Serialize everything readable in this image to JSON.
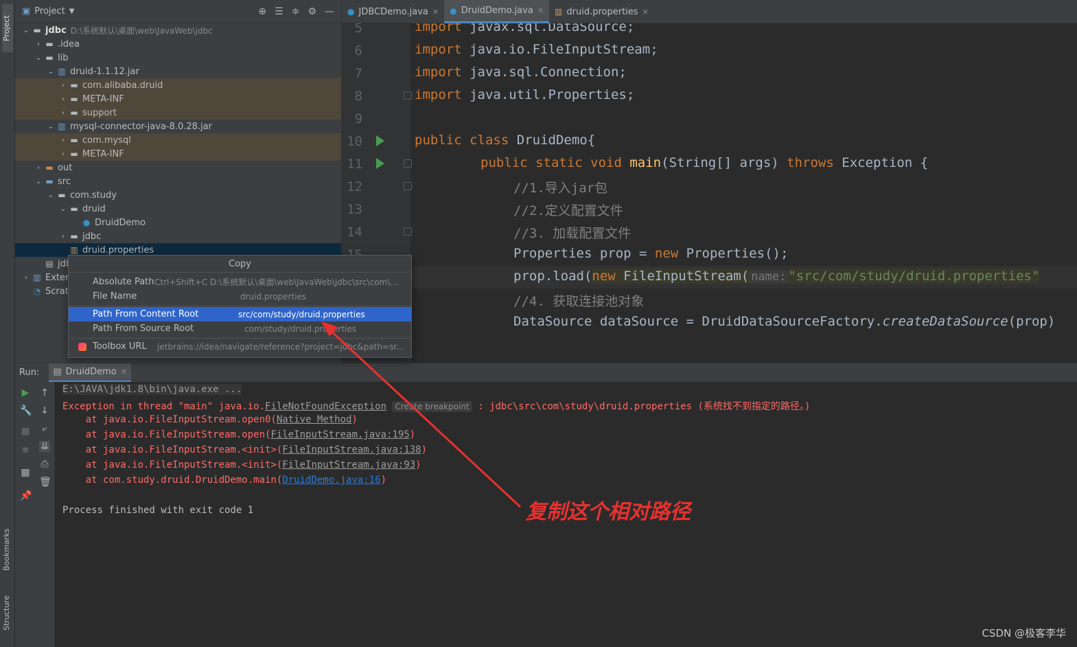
{
  "sidebar_strip": {
    "project": "Project",
    "bookmarks": "Bookmarks",
    "structure": "Structure"
  },
  "project_panel": {
    "title": "Project",
    "tree": [
      {
        "label": "jdbc",
        "hint": "D:\\系统默认\\桌面\\web\\JavaWeb\\jdbc",
        "depth": 0,
        "arrow": "down",
        "icon": "folder-icon"
      },
      {
        "label": ".idea",
        "depth": 1,
        "arrow": "right",
        "icon": "folder-icon"
      },
      {
        "label": "lib",
        "depth": 1,
        "arrow": "down",
        "icon": "folder-icon"
      },
      {
        "label": "druid-1.1.12.jar",
        "depth": 2,
        "arrow": "down",
        "icon": "jar-icon"
      },
      {
        "label": "com.alibaba.druid",
        "depth": 3,
        "arrow": "right",
        "icon": "package-icon"
      },
      {
        "label": "META-INF",
        "depth": 3,
        "arrow": "right",
        "icon": "folder-icon"
      },
      {
        "label": "support",
        "depth": 3,
        "arrow": "right",
        "icon": "folder-icon"
      },
      {
        "label": "mysql-connector-java-8.0.28.jar",
        "depth": 2,
        "arrow": "down",
        "icon": "jar-icon"
      },
      {
        "label": "com.mysql",
        "depth": 3,
        "arrow": "right",
        "icon": "package-icon"
      },
      {
        "label": "META-INF",
        "depth": 3,
        "arrow": "right",
        "icon": "folder-icon"
      },
      {
        "label": "out",
        "depth": 1,
        "arrow": "right",
        "icon": "folder-icon"
      },
      {
        "label": "src",
        "depth": 1,
        "arrow": "down",
        "icon": "folder-icon"
      },
      {
        "label": "com.study",
        "depth": 2,
        "arrow": "down",
        "icon": "package-icon"
      },
      {
        "label": "druid",
        "depth": 3,
        "arrow": "down",
        "icon": "package-icon"
      },
      {
        "label": "DruidDemo",
        "depth": 4,
        "arrow": "",
        "icon": "class-icon"
      },
      {
        "label": "jdbc",
        "depth": 3,
        "arrow": "right",
        "icon": "package-icon"
      },
      {
        "label": "druid.properties",
        "depth": 3,
        "arrow": "",
        "icon": "properties-icon"
      },
      {
        "label": "jdb",
        "depth": 1,
        "arrow": "",
        "icon": "file-icon"
      },
      {
        "label": "Extern",
        "depth": 0,
        "arrow": "right",
        "icon": "library-icon"
      },
      {
        "label": "Scratc",
        "depth": 0,
        "arrow": "",
        "icon": "scratch-icon"
      }
    ]
  },
  "tabs": [
    {
      "label": "JDBCDemo.java",
      "icon": "java-class-icon"
    },
    {
      "label": "DruidDemo.java",
      "icon": "java-class-icon"
    },
    {
      "label": "druid.properties",
      "icon": "properties-file-icon"
    }
  ],
  "editor": {
    "line_numbers": [
      "5",
      "6",
      "7",
      "8",
      "9",
      "10",
      "11",
      "12",
      "13",
      "14",
      "15"
    ],
    "import_kw": "import",
    "imports": [
      "javax.sql.DataSource;",
      "java.io.FileInputStream;",
      "java.sql.Connection;",
      "java.util.Properties;"
    ],
    "l10_public": "public",
    "l10_class": "class",
    "l10_rest": "DruidDemo{",
    "l11_mods": "public static void",
    "l11_main": "main",
    "l11_params": "(String[] args)",
    "l11_throws": "throws",
    "l11_tail": "Exception {",
    "c1": "//1.导入jar包",
    "c2": "//2.定义配置文件",
    "c3": "//3. 加载配置文件",
    "l15_a": "Properties prop = ",
    "l15_new": "new",
    "l15_b": " Properties();",
    "l16_a": "prop.load(",
    "l16_new": "new",
    "l16_b": " FileInputStream(",
    "l16_hint": "name:",
    "l16_str": "\"src/com/study/druid.properties\"",
    "c4": "//4. 获取连接池对象",
    "l18_a": "DataSource dataSource = DruidDataSourceFactory.",
    "l18_m": "createDataSource",
    "l18_b": "(prop)"
  },
  "popup": {
    "title": "Copy",
    "items": [
      {
        "label": "Absolute Path",
        "shortcut": "Ctrl+Shift+C",
        "value": "D:\\系统默认\\桌面\\web\\JavaWeb\\jdbc\\src\\com\\..."
      },
      {
        "label": "File Name",
        "shortcut": "",
        "value": "druid.properties"
      },
      {
        "label": "Path From Content Root",
        "shortcut": "",
        "value": "src/com/study/druid.properties"
      },
      {
        "label": "Path From Source Root",
        "shortcut": "",
        "value": "com/study/druid.properties"
      },
      {
        "label": "Toolbox URL",
        "shortcut": "",
        "value": "jetbrains://idea/navigate/reference?project=jdbc&path=sr..."
      }
    ]
  },
  "run": {
    "label": "Run:",
    "tab": "DruidDemo",
    "console": {
      "cmd": "E:\\JAVA\\jdk1.8\\bin\\java.exe ...",
      "exc_prefix": "Exception in thread \"main\" java.io.",
      "exc_class": "FileNotFoundException",
      "create_bp": "Create breakpoint",
      "exc_tail": ": jdbc\\src\\com\\study\\druid.properties (系统找不到指定的路径。)",
      "stack": [
        {
          "pre": "    at java.io.FileInputStream.open0(",
          "link": "Native Method",
          "post": ")"
        },
        {
          "pre": "    at java.io.FileInputStream.open(",
          "link": "FileInputStream.java:195",
          "post": ")"
        },
        {
          "pre": "    at java.io.FileInputStream.<init>(",
          "link": "FileInputStream.java:138",
          "post": ")"
        },
        {
          "pre": "    at java.io.FileInputStream.<init>(",
          "link": "FileInputStream.java:93",
          "post": ")"
        },
        {
          "pre": "    at com.study.druid.DruidDemo.main(",
          "link": "DruidDemo.java:16",
          "post": ")"
        }
      ],
      "finished": "Process finished with exit code 1"
    }
  },
  "annotation": {
    "text": "复制这个相对路径",
    "color": "#e8312f"
  },
  "watermark": "CSDN @极客李华",
  "colors": {
    "accent": "#2f65ca",
    "keyword": "#cc7832",
    "string": "#6a8759",
    "error": "#ff6b68",
    "run_green": "#499c54"
  }
}
